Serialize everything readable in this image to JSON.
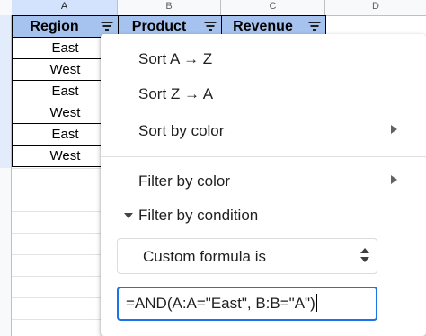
{
  "columns": [
    "A",
    "B",
    "C",
    "D"
  ],
  "headers": {
    "region": "Region",
    "product": "Product",
    "revenue": "Revenue"
  },
  "region_values": [
    "East",
    "West",
    "East",
    "West",
    "East",
    "West"
  ],
  "menu": {
    "sort_az": "Sort A → Z",
    "sort_za": "Sort Z → A",
    "sort_by_color": "Sort by color",
    "filter_by_color": "Filter by color",
    "filter_by_condition": "Filter by condition",
    "condition_selected": "Custom formula is",
    "formula_value": "=AND(A:A=\"East\", B:B=\"A\")"
  },
  "colors": {
    "header_fill": "#a5c3ee",
    "accent": "#1a73e8"
  }
}
